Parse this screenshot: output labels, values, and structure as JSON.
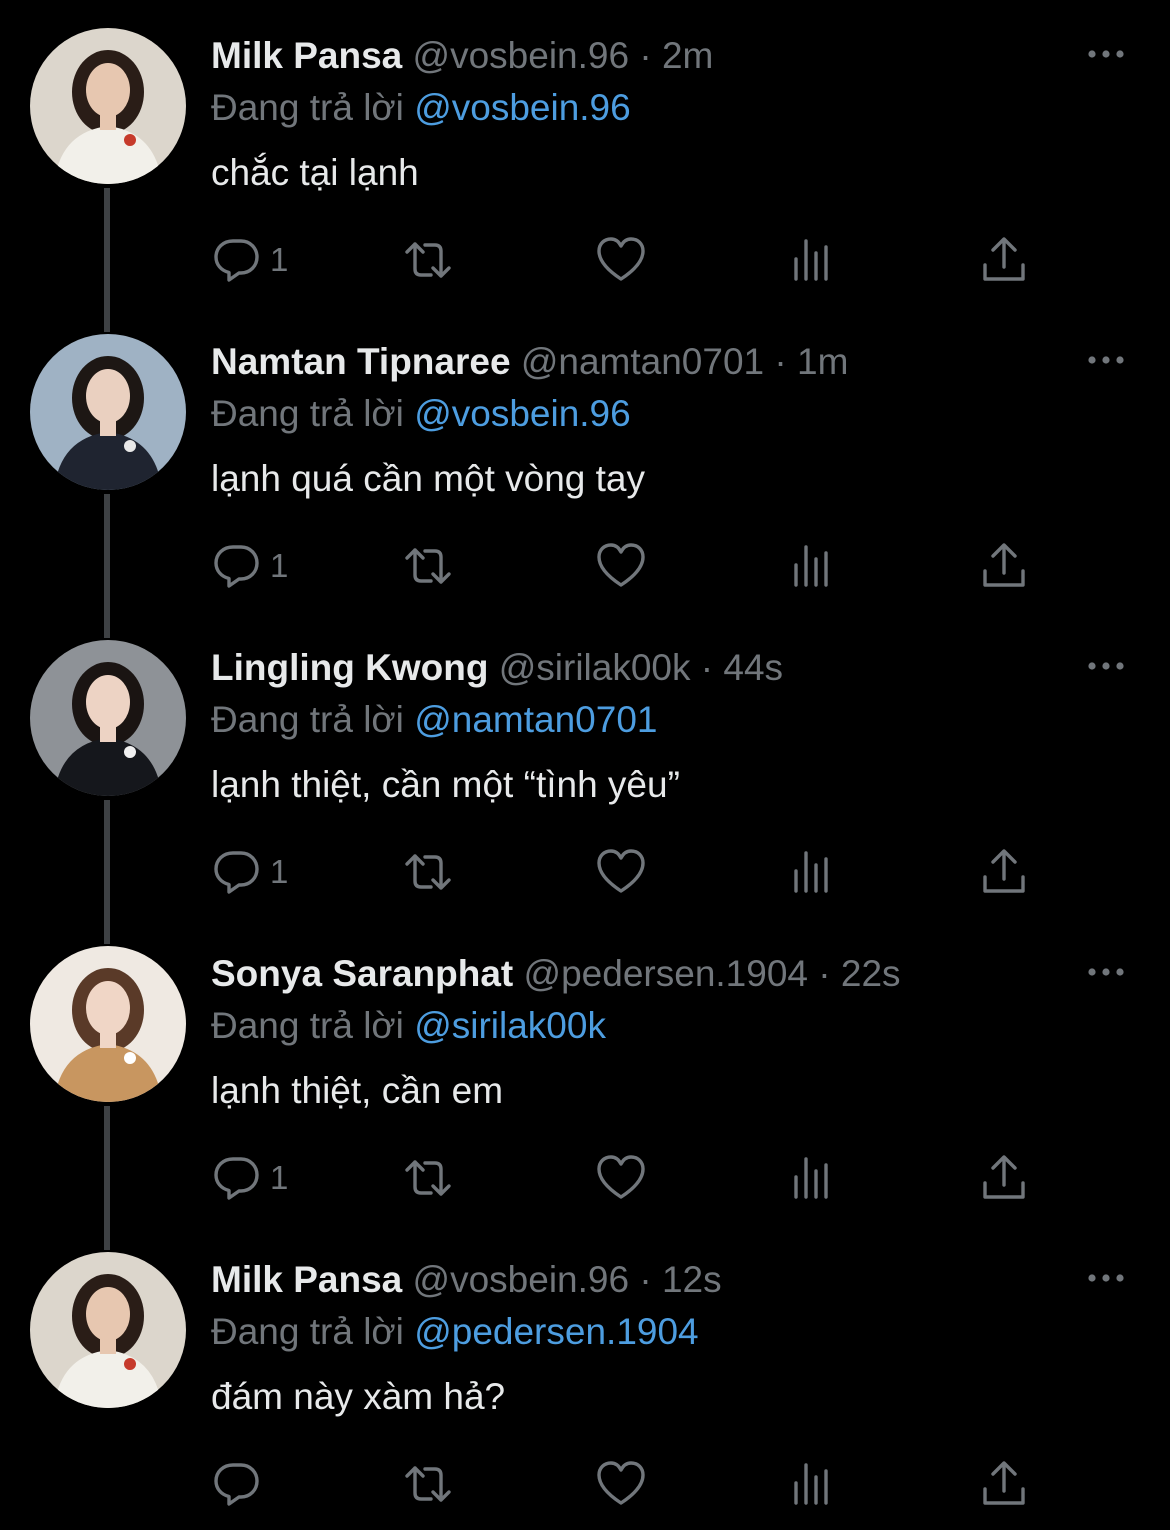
{
  "thread": [
    {
      "name": "Milk Pansa",
      "handle": "@vosbein.96",
      "time": "2m",
      "reply_prefix": "Đang trả lời",
      "reply_to": "@vosbein.96",
      "text": "chắc tại lạnh",
      "reply_count": "1",
      "avatar": {
        "bg": "#dcd6cc",
        "hair": "#2a1d17",
        "skin": "#e7c7b0",
        "cloth": "#f2f0ea",
        "accent": "#c63a2b"
      }
    },
    {
      "name": "Namtan Tipnaree",
      "handle": "@namtan0701",
      "time": "1m",
      "reply_prefix": "Đang trả lời",
      "reply_to": "@vosbein.96",
      "text": "lạnh quá cần một vòng tay",
      "reply_count": "1",
      "avatar": {
        "bg": "#9fb2c4",
        "hair": "#1d1714",
        "skin": "#ead0c0",
        "cloth": "#1f2430",
        "accent": "#e8e8e8"
      }
    },
    {
      "name": "Lingling Kwong",
      "handle": "@sirilak00k",
      "time": "44s",
      "reply_prefix": "Đang trả lời",
      "reply_to": "@namtan0701",
      "text": "lạnh thiệt, cần một “tình yêu”",
      "reply_count": "1",
      "avatar": {
        "bg": "#8e9297",
        "hair": "#1a1412",
        "skin": "#edd3c4",
        "cloth": "#15171c",
        "accent": "#f0f0f0"
      }
    },
    {
      "name": "Sonya Saranphat",
      "handle": "@pedersen.1904",
      "time": "22s",
      "reply_prefix": "Đang trả lời",
      "reply_to": "@sirilak00k",
      "text": "lạnh thiệt, cần em",
      "reply_count": "1",
      "avatar": {
        "bg": "#efe9e2",
        "hair": "#5a3a28",
        "skin": "#f0d6c6",
        "cloth": "#c89660",
        "accent": "#ffffff"
      }
    },
    {
      "name": "Milk Pansa",
      "handle": "@vosbein.96",
      "time": "12s",
      "reply_prefix": "Đang trả lời",
      "reply_to": "@pedersen.1904",
      "text": "đám này xàm hả?",
      "reply_count": "",
      "avatar": {
        "bg": "#dcd6cc",
        "hair": "#2a1d17",
        "skin": "#e7c7b0",
        "cloth": "#f2f0ea",
        "accent": "#c63a2b"
      }
    }
  ],
  "separator": "·",
  "icons": {
    "more": "more-horizontal-icon",
    "reply": "reply-bubble-icon",
    "retweet": "retweet-icon",
    "like": "heart-icon",
    "views": "views-chart-icon",
    "share": "share-upload-icon"
  },
  "colors": {
    "background": "#000000",
    "primary_text": "#e7e9ea",
    "secondary_text": "#71767b",
    "link": "#4d9de0",
    "thread_line": "#3e4144"
  }
}
